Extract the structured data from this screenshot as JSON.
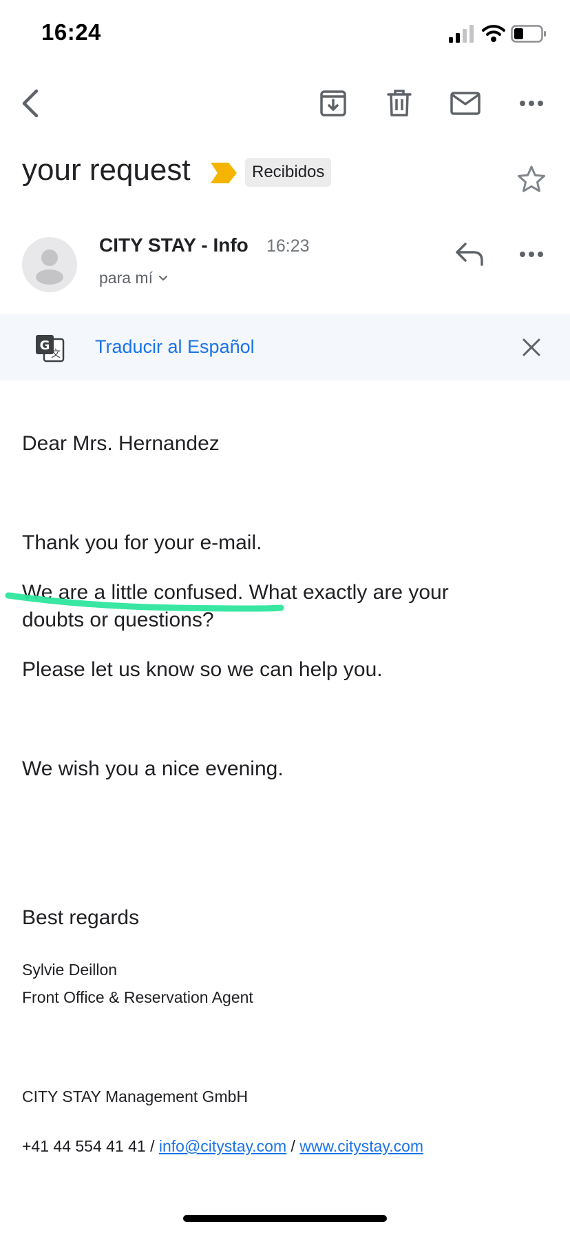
{
  "status_bar": {
    "time": "16:24"
  },
  "email": {
    "subject": "your request",
    "label": "Recibidos",
    "sender": {
      "name": "CITY STAY - Info",
      "time": "16:23",
      "recipient": "para mí"
    },
    "translate": {
      "label": "Traducir al Español"
    },
    "body": {
      "greeting": "Dear Mrs. Hernandez",
      "line1": "Thank you for your e-mail.",
      "line2": "We are a little confused. What exactly are your doubts or questions?",
      "line3": "Please let us know so we can help you.",
      "line4": "We wish you a nice evening.",
      "closing": "Best regards",
      "signature_name": "Sylvie Deillon",
      "signature_title": "Front Office & Reservation Agent",
      "company": "CITY STAY Management GmbH",
      "phone": "+41 44 554 41 41",
      "separator": "/",
      "email": "info@citystay.com",
      "website": "www.citystay.com"
    }
  },
  "colors": {
    "accent": "#1a73e8",
    "importance": "#f4b400",
    "highlight": "#2ee59d"
  }
}
